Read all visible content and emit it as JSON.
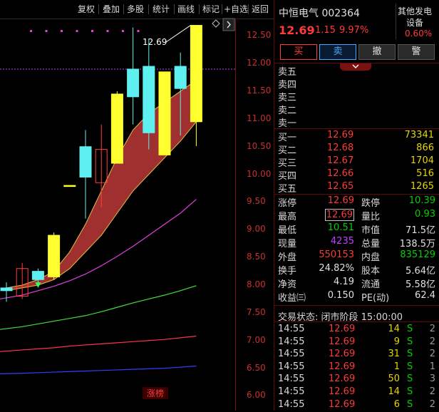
{
  "toolbar": {
    "buttons": [
      "复权",
      "叠加",
      "多股",
      "统计",
      "画线",
      "标记",
      "+自选",
      "返回"
    ]
  },
  "chart": {
    "y_ticks": [
      "12.50",
      "12.00",
      "11.50",
      "11.00",
      "10.50",
      "10.00",
      "9.50",
      "9.00",
      "8.50",
      "8.00",
      "7.50",
      "7.00",
      "6.50",
      "6.00"
    ],
    "high_label": "12.69",
    "bottom_tag": "涨榜",
    "icon_diamond": "diamond-icon"
  },
  "header": {
    "name_code": "中恒电气 002364",
    "price": "12.69",
    "change": "1.15",
    "change_pct": "9.97%",
    "sector_l1": "其他发电",
    "sector_l2": "设备",
    "sector_pct": "0.60%"
  },
  "trade": {
    "buy": "买",
    "sell": "卖",
    "cancel": "撤",
    "alert": "警"
  },
  "asks": [
    {
      "label": "卖五",
      "price": "",
      "vol": ""
    },
    {
      "label": "卖四",
      "price": "",
      "vol": ""
    },
    {
      "label": "卖三",
      "price": "",
      "vol": ""
    },
    {
      "label": "卖二",
      "price": "",
      "vol": ""
    },
    {
      "label": "卖一",
      "price": "",
      "vol": ""
    }
  ],
  "bids": [
    {
      "label": "买一",
      "price": "12.69",
      "vol": "73341"
    },
    {
      "label": "买二",
      "price": "12.68",
      "vol": "866"
    },
    {
      "label": "买三",
      "price": "12.67",
      "vol": "1704"
    },
    {
      "label": "买四",
      "price": "12.66",
      "vol": "516"
    },
    {
      "label": "买五",
      "price": "12.65",
      "vol": "1265"
    }
  ],
  "stats": [
    {
      "l1": "涨停",
      "v1": "12.69",
      "c1": "red",
      "l2": "跌停",
      "v2": "10.39",
      "c2": "green"
    },
    {
      "l1": "最高",
      "v1": "12.69",
      "c1": "red boxed",
      "l2": "量比",
      "v2": "0.93",
      "c2": "green"
    },
    {
      "l1": "最低",
      "v1": "10.51",
      "c1": "green",
      "l2": "市值",
      "v2": "71.5亿",
      "c2": "white"
    },
    {
      "l1": "现量",
      "v1": "4235",
      "c1": "purple",
      "l2": "总量",
      "v2": "138.5万",
      "c2": "white"
    },
    {
      "l1": "外盘",
      "v1": "550153",
      "c1": "red",
      "l2": "内盘",
      "v2": "835129",
      "c2": "green"
    },
    {
      "l1": "换手",
      "v1": "24.82%",
      "c1": "white",
      "l2": "股本",
      "v2": "5.64亿",
      "c2": "white"
    },
    {
      "l1": "净资",
      "v1": "4.19",
      "c1": "white",
      "l2": "流通",
      "v2": "5.58亿",
      "c2": "white"
    },
    {
      "l1": "收益㈢",
      "v1": "0.150",
      "c1": "white",
      "l2": "PE(动)",
      "v2": "62.4",
      "c2": "white"
    }
  ],
  "status": "交易状态: 闭市阶段 15:00:00",
  "ticks": [
    {
      "time": "14:55",
      "price": "12.69",
      "vol": "14",
      "side": "S",
      "cnt": "2"
    },
    {
      "time": "14:55",
      "price": "12.69",
      "vol": "9",
      "side": "S",
      "cnt": "2"
    },
    {
      "time": "14:55",
      "price": "12.69",
      "vol": "31",
      "side": "S",
      "cnt": "2"
    },
    {
      "time": "14:55",
      "price": "12.69",
      "vol": "1",
      "side": "S",
      "cnt": "1"
    },
    {
      "time": "14:55",
      "price": "12.69",
      "vol": "50",
      "side": "S",
      "cnt": "3"
    },
    {
      "time": "14:55",
      "price": "12.69",
      "vol": "14",
      "side": "S",
      "cnt": "2"
    },
    {
      "time": "14:55",
      "price": "12.69",
      "vol": "6",
      "side": "S",
      "cnt": "2"
    }
  ],
  "chart_data": {
    "type": "candlestick",
    "ylim": [
      5.8,
      12.8
    ],
    "candles": [
      {
        "o": 7.9,
        "h": 8.05,
        "l": 7.7,
        "c": 7.95,
        "color": "cyan"
      },
      {
        "o": 7.8,
        "h": 8.4,
        "l": 7.75,
        "c": 8.3,
        "color": "red"
      },
      {
        "o": 8.1,
        "h": 8.3,
        "l": 8.0,
        "c": 8.25,
        "color": "cyan"
      },
      {
        "o": 8.15,
        "h": 8.95,
        "l": 8.1,
        "c": 8.9,
        "color": "yellow"
      },
      {
        "o": 9.8,
        "h": 9.8,
        "l": 9.8,
        "c": 9.8,
        "color": "yellow"
      },
      {
        "o": 10.5,
        "h": 10.8,
        "l": 9.2,
        "c": 9.95,
        "color": "cyan"
      },
      {
        "o": 9.85,
        "h": 10.9,
        "l": 9.4,
        "c": 10.45,
        "color": "red"
      },
      {
        "o": 10.2,
        "h": 11.5,
        "l": 10.2,
        "c": 11.45,
        "color": "yellow"
      },
      {
        "o": 11.9,
        "h": 12.65,
        "l": 10.9,
        "c": 11.4,
        "color": "cyan"
      },
      {
        "o": 11.95,
        "h": 12.45,
        "l": 10.45,
        "c": 10.75,
        "color": "cyan"
      },
      {
        "o": 10.35,
        "h": 11.85,
        "l": 10.35,
        "c": 11.85,
        "color": "yellow"
      },
      {
        "o": 11.95,
        "h": 12.2,
        "l": 10.7,
        "c": 11.55,
        "color": "cyan"
      },
      {
        "o": 10.95,
        "h": 12.69,
        "l": 10.51,
        "c": 12.69,
        "color": "yellow"
      }
    ],
    "ma_band_upper": [
      7.95,
      8.0,
      8.1,
      8.25,
      8.6,
      9.1,
      9.7,
      10.3,
      10.8,
      11.1,
      11.3,
      11.5,
      11.7
    ],
    "ma_band_lower": [
      7.9,
      7.95,
      8.0,
      8.1,
      8.3,
      8.6,
      8.9,
      9.3,
      9.7,
      10.0,
      10.3,
      10.6,
      10.95
    ],
    "ma_magenta": [
      7.75,
      7.82,
      7.9,
      7.98,
      8.08,
      8.2,
      8.35,
      8.52,
      8.7,
      8.9,
      9.1,
      9.3,
      9.55
    ],
    "ma_green": [
      7.2,
      7.25,
      7.3,
      7.35,
      7.4,
      7.45,
      7.52,
      7.6,
      7.68,
      7.75,
      7.82,
      7.9,
      7.99
    ],
    "ma_red": [
      6.8,
      6.83,
      6.85,
      6.87,
      6.9,
      6.92,
      6.94,
      6.96,
      6.98,
      7.0,
      7.02,
      7.05,
      7.08
    ],
    "ma_blue": [
      6.4,
      6.41,
      6.42,
      6.43,
      6.44,
      6.45,
      6.46,
      6.47,
      6.48,
      6.49,
      6.5,
      6.52,
      6.54
    ],
    "ref_line": 11.9
  }
}
